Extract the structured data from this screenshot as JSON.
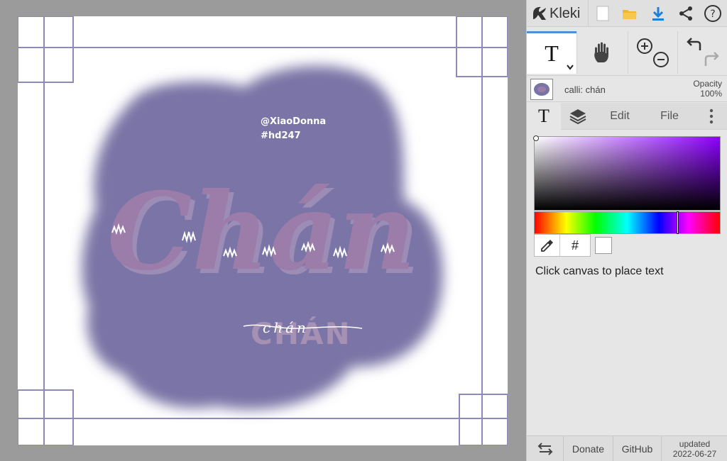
{
  "app": {
    "name": "Kleki"
  },
  "canvas": {
    "artwork": {
      "handle": "@XiaoDonna",
      "hashtag": "#hd247",
      "main_word": "Chán",
      "sub_word_caps": "CHÁN",
      "sub_word_script": "chán",
      "blob_color": "#7a74a6",
      "lettering_color": "#9c7ca8",
      "frame_line_color": "#8e8ab8"
    }
  },
  "tools": {
    "active": "text-tool",
    "text_glyph": "T"
  },
  "layer": {
    "name": "calli: chán",
    "opacity_label": "Opacity",
    "opacity_value": "100%"
  },
  "tabs": {
    "text_glyph": "T",
    "edit": "Edit",
    "file": "File"
  },
  "color": {
    "hex_label": "#",
    "current": "#ffffff",
    "hue_accent": "#8c00ff"
  },
  "hint": "Click canvas to place text",
  "footer": {
    "donate": "Donate",
    "github": "GitHub",
    "updated_label": "updated",
    "updated_date": "2022-06-27"
  }
}
